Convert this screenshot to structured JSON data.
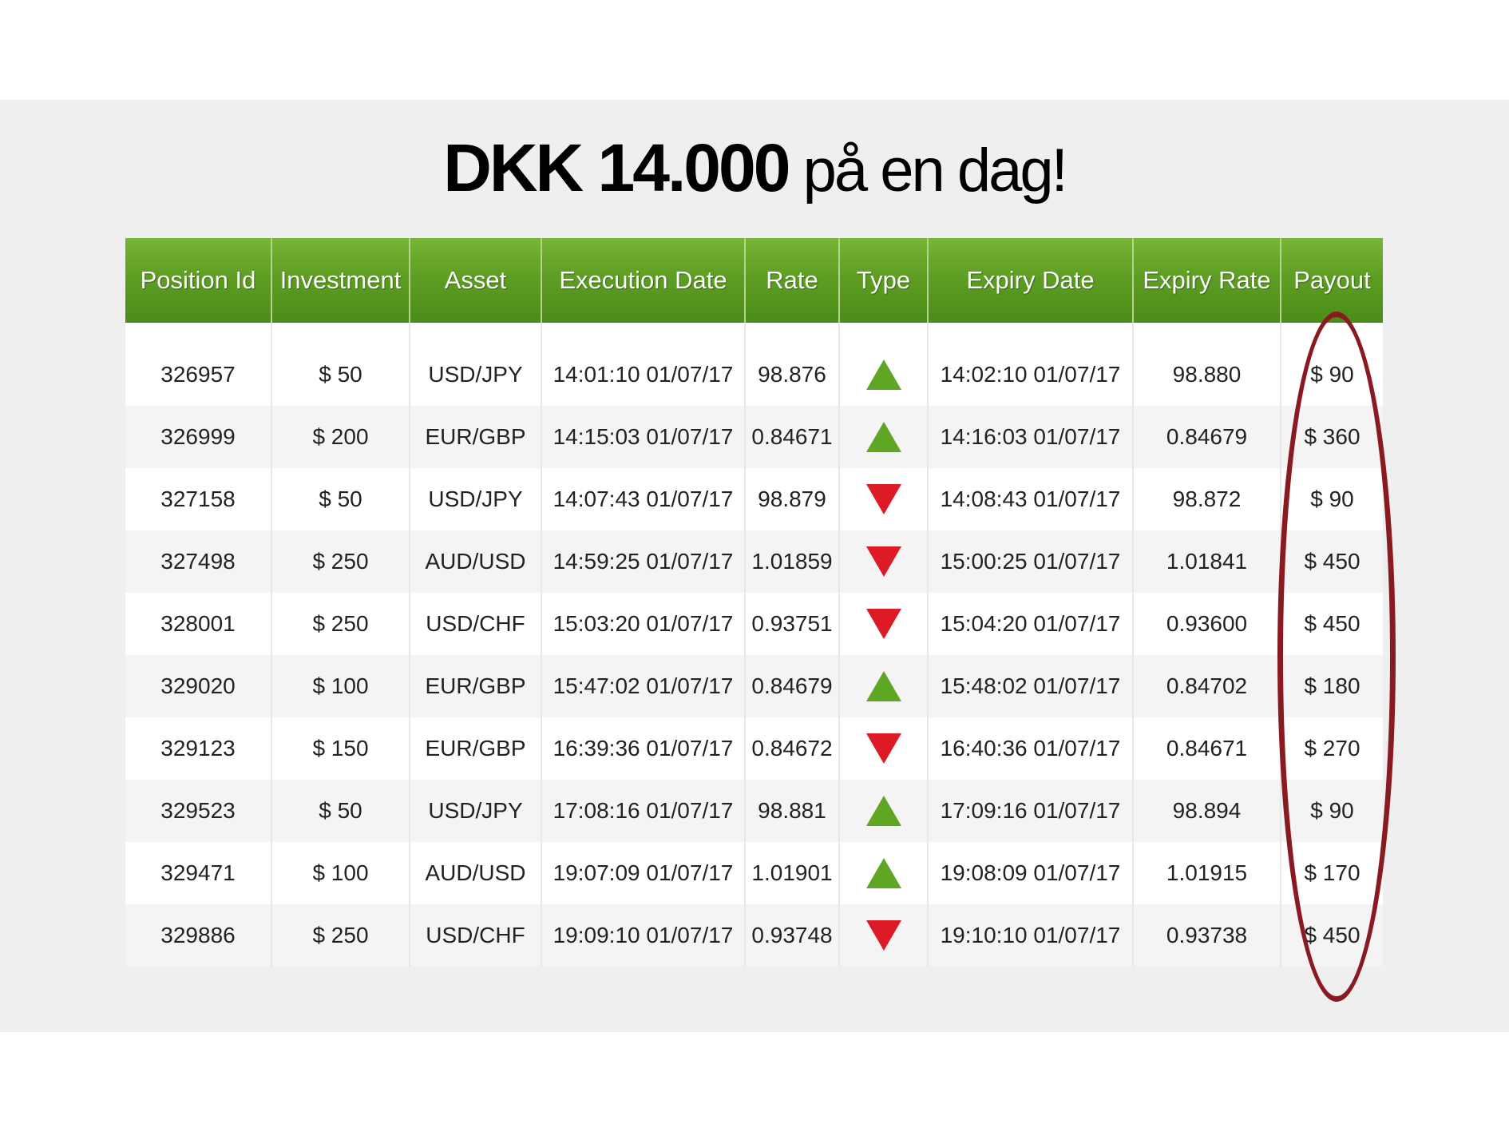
{
  "headline": {
    "strong": "DKK 14.000",
    "light": " på en dag!"
  },
  "table": {
    "columns": [
      "Position Id",
      "Investment",
      "Asset",
      "Execution Date",
      "Rate",
      "Type",
      "Expiry Date",
      "Expiry Rate",
      "Payout"
    ],
    "rows": [
      {
        "position_id": "326957",
        "investment": "$ 50",
        "asset": "USD/JPY",
        "execution_date": "14:01:10 01/07/17",
        "rate": "98.876",
        "type": "up",
        "expiry_date": "14:02:10 01/07/17",
        "expiry_rate": "98.880",
        "payout": "$ 90"
      },
      {
        "position_id": "326999",
        "investment": "$ 200",
        "asset": "EUR/GBP",
        "execution_date": "14:15:03 01/07/17",
        "rate": "0.84671",
        "type": "up",
        "expiry_date": "14:16:03 01/07/17",
        "expiry_rate": "0.84679",
        "payout": "$ 360"
      },
      {
        "position_id": "327158",
        "investment": "$ 50",
        "asset": "USD/JPY",
        "execution_date": "14:07:43 01/07/17",
        "rate": "98.879",
        "type": "down",
        "expiry_date": "14:08:43 01/07/17",
        "expiry_rate": "98.872",
        "payout": "$ 90"
      },
      {
        "position_id": "327498",
        "investment": "$ 250",
        "asset": "AUD/USD",
        "execution_date": "14:59:25 01/07/17",
        "rate": "1.01859",
        "type": "down",
        "expiry_date": "15:00:25 01/07/17",
        "expiry_rate": "1.01841",
        "payout": "$ 450"
      },
      {
        "position_id": "328001",
        "investment": "$ 250",
        "asset": "USD/CHF",
        "execution_date": "15:03:20 01/07/17",
        "rate": "0.93751",
        "type": "down",
        "expiry_date": "15:04:20 01/07/17",
        "expiry_rate": "0.93600",
        "payout": "$ 450"
      },
      {
        "position_id": "329020",
        "investment": "$ 100",
        "asset": "EUR/GBP",
        "execution_date": "15:47:02 01/07/17",
        "rate": "0.84679",
        "type": "up",
        "expiry_date": "15:48:02 01/07/17",
        "expiry_rate": "0.84702",
        "payout": "$ 180"
      },
      {
        "position_id": "329123",
        "investment": "$ 150",
        "asset": "EUR/GBP",
        "execution_date": "16:39:36 01/07/17",
        "rate": "0.84672",
        "type": "down",
        "expiry_date": "16:40:36 01/07/17",
        "expiry_rate": "0.84671",
        "payout": "$ 270"
      },
      {
        "position_id": "329523",
        "investment": "$ 50",
        "asset": "USD/JPY",
        "execution_date": "17:08:16 01/07/17",
        "rate": "98.881",
        "type": "up",
        "expiry_date": "17:09:16 01/07/17",
        "expiry_rate": "98.894",
        "payout": "$ 90"
      },
      {
        "position_id": "329471",
        "investment": "$ 100",
        "asset": "AUD/USD",
        "execution_date": "19:07:09 01/07/17",
        "rate": "1.01901",
        "type": "up",
        "expiry_date": "19:08:09 01/07/17",
        "expiry_rate": "1.01915",
        "payout": "$ 170"
      },
      {
        "position_id": "329886",
        "investment": "$ 250",
        "asset": "USD/CHF",
        "execution_date": "19:09:10 01/07/17",
        "rate": "0.93748",
        "type": "down",
        "expiry_date": "19:10:10 01/07/17",
        "expiry_rate": "0.93738",
        "payout": "$ 450"
      }
    ]
  },
  "icons": {
    "up": "triangle-up-icon",
    "down": "triangle-down-icon"
  },
  "colors": {
    "header_green": "#5e9e23",
    "up_green": "#5ea623",
    "down_red": "#dd1b27",
    "highlight_ring": "#8a1a22"
  }
}
